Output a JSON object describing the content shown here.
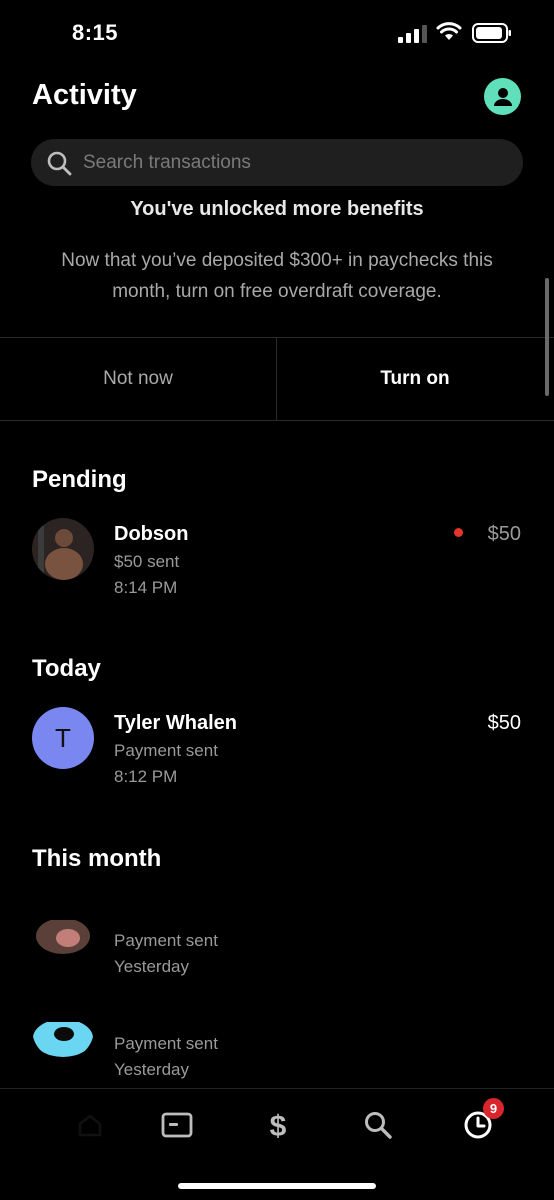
{
  "status_bar": {
    "time": "8:15"
  },
  "header": {
    "title": "Activity"
  },
  "search": {
    "placeholder": "Search transactions"
  },
  "banner": {
    "title": "You've unlocked more benefits",
    "body": "Now that you’ve deposited $300+ in paychecks this month, turn on free overdraft coverage.",
    "dismiss_label": "Not now",
    "confirm_label": "Turn on"
  },
  "sections": {
    "pending": {
      "title": "Pending",
      "items": [
        {
          "name": "Dobson",
          "subtitle": "$50 sent",
          "time": "8:14 PM",
          "amount": "$50"
        }
      ]
    },
    "today": {
      "title": "Today",
      "items": [
        {
          "initial": "T",
          "name": "Tyler Whalen",
          "subtitle": "Payment sent",
          "time": "8:12 PM",
          "amount": "$50"
        }
      ]
    },
    "this_month": {
      "title": "This month",
      "items": [
        {
          "subtitle": "Payment sent",
          "time": "Yesterday"
        },
        {
          "subtitle": "Payment sent",
          "time": "Yesterday"
        }
      ]
    }
  },
  "tab_bar": {
    "tabs": [
      "home-icon",
      "card-icon",
      "dollar-icon",
      "search-icon",
      "activity-clock-icon"
    ],
    "badge_count": "9"
  },
  "colors": {
    "accent": "#5fe0bb",
    "pending_dot": "#e5352b",
    "letter_avatar": "#7b87f0",
    "badge": "#d8262c"
  }
}
